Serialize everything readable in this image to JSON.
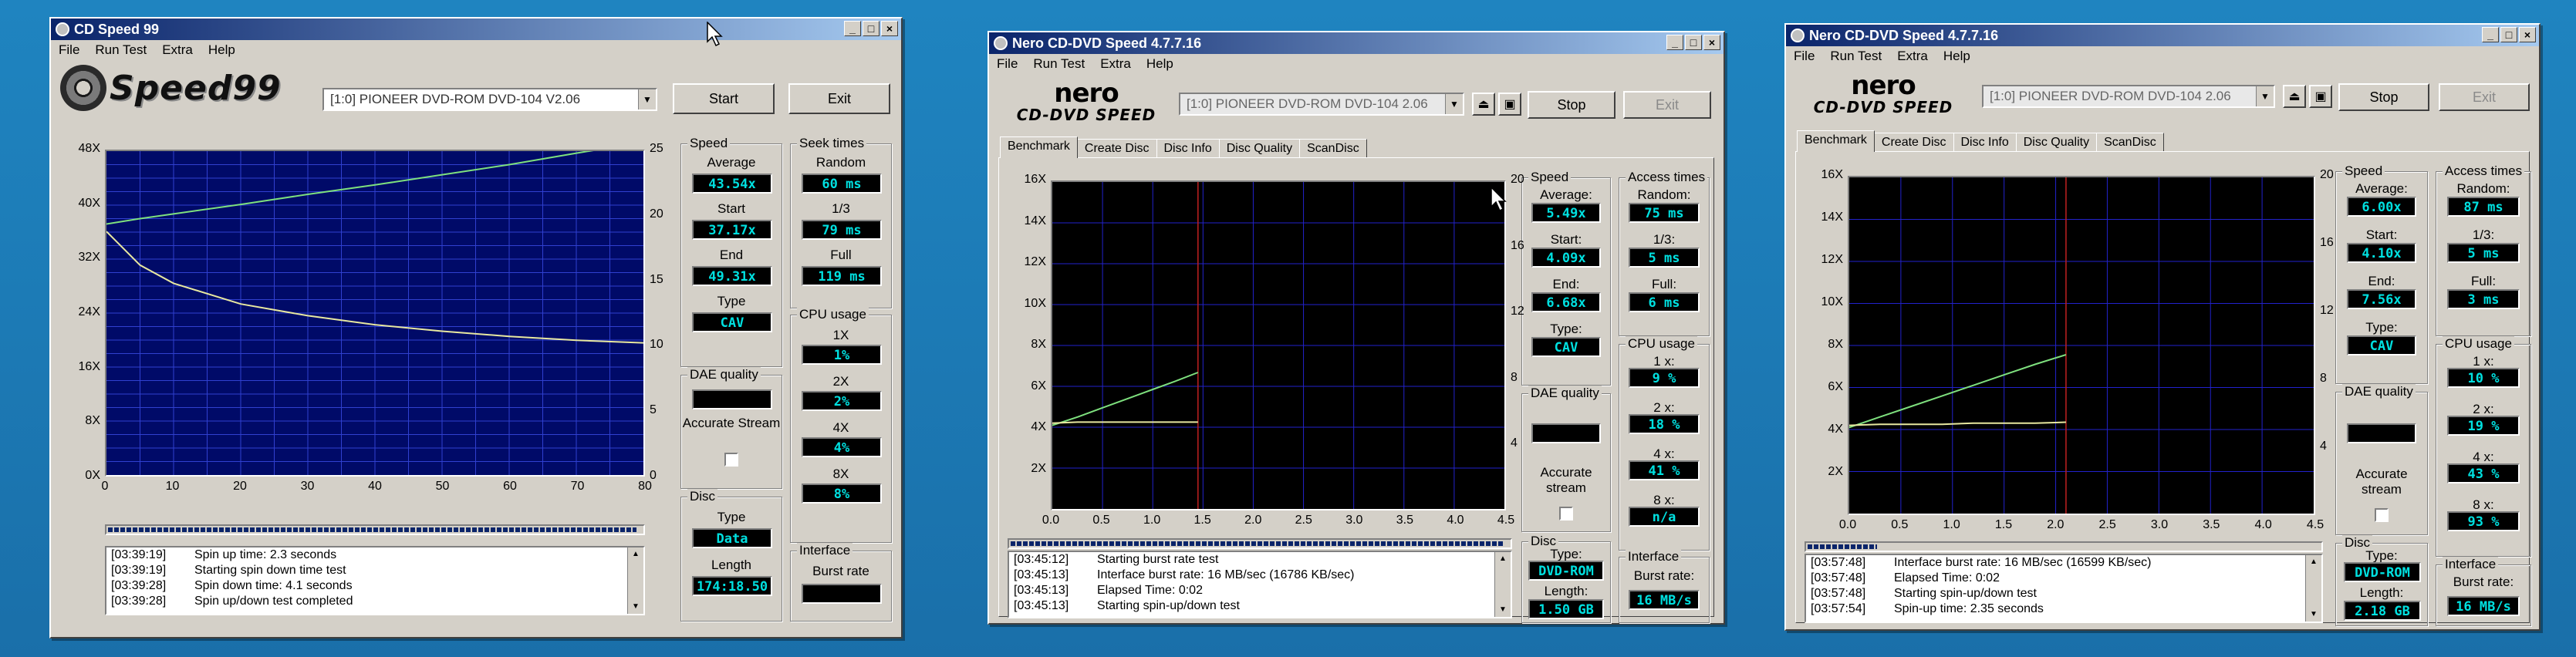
{
  "windows": {
    "w1": {
      "title": "CD Speed 99",
      "menu": [
        "File",
        "Run Test",
        "Extra",
        "Help"
      ],
      "logo_text": "Speed99",
      "drive": "[1:0]  PIONEER DVD-ROM DVD-104 V2.06",
      "start_label": "Start",
      "exit_label": "Exit",
      "speed": {
        "title": "Speed",
        "average_label": "Average",
        "average": "43.54x",
        "start_label": "Start",
        "start": "37.17x",
        "end_label": "End",
        "end": "49.31x",
        "type_label": "Type",
        "type": "CAV"
      },
      "seek": {
        "title": "Seek times",
        "random_label": "Random",
        "random": "60 ms",
        "third_label": "1/3",
        "third": "79 ms",
        "full_label": "Full",
        "full": "119 ms"
      },
      "cpu": {
        "title": "CPU usage",
        "labels": [
          "1X",
          "2X",
          "4X",
          "8X"
        ],
        "values": [
          "1%",
          "2%",
          "4%",
          "8%"
        ]
      },
      "dae": {
        "title": "DAE quality",
        "accurate_label": "Accurate Stream"
      },
      "disc": {
        "title": "Disc",
        "type_label": "Type",
        "type": "Data",
        "length_label": "Length",
        "length": "174:18.50"
      },
      "interface": {
        "title": "Interface",
        "burst_label": "Burst rate"
      },
      "progress": 0.99,
      "log": [
        {
          "t": "[03:39:19]",
          "m": "Spin up time: 2.3 seconds"
        },
        {
          "t": "[03:39:19]",
          "m": "Starting spin down time test"
        },
        {
          "t": "[03:39:28]",
          "m": "Spin down time: 4.1 seconds"
        },
        {
          "t": "[03:39:28]",
          "m": "Spin up/down test completed"
        }
      ]
    },
    "w2": {
      "title": "Nero CD-DVD Speed 4.7.7.16",
      "menu": [
        "File",
        "Run Test",
        "Extra",
        "Help"
      ],
      "logo_top": "nero",
      "logo_bottom": "CD-DVD SPEED",
      "drive": "[1:0]  PIONEER DVD-ROM DVD-104 2.06",
      "stop_label": "Stop",
      "exit_label": "Exit",
      "tabs": [
        "Benchmark",
        "Create Disc",
        "Disc Info",
        "Disc Quality",
        "ScanDisc"
      ],
      "speed": {
        "title": "Speed",
        "average_label": "Average:",
        "average": "5.49x",
        "start_label": "Start:",
        "start": "4.09x",
        "end_label": "End:",
        "end": "6.68x",
        "type_label": "Type:",
        "type": "CAV"
      },
      "access": {
        "title": "Access times",
        "random_label": "Random:",
        "random": "75 ms",
        "third_label": "1/3:",
        "third": "5 ms",
        "full_label": "Full:",
        "full": "6 ms"
      },
      "cpu": {
        "title": "CPU usage",
        "labels": [
          "1 x:",
          "2 x:",
          "4 x:",
          "8 x:"
        ],
        "values": [
          "9 %",
          "18 %",
          "41 %",
          "n/a"
        ]
      },
      "dae": {
        "title": "DAE quality",
        "accurate_label": "Accurate stream"
      },
      "disc": {
        "title": "Disc",
        "type_label": "Type:",
        "type": "DVD-ROM",
        "length_label": "Length:",
        "length": "1.50 GB"
      },
      "interface": {
        "title": "Interface",
        "burst_label": "Burst rate:",
        "burst": "16 MB/s"
      },
      "progress": 0.99,
      "log": [
        {
          "t": "[03:45:12]",
          "m": "Starting burst rate test"
        },
        {
          "t": "[03:45:13]",
          "m": "Interface burst rate: 16 MB/sec (16786 KB/sec)"
        },
        {
          "t": "[03:45:13]",
          "m": "Elapsed Time:  0:02"
        },
        {
          "t": "[03:45:13]",
          "m": "Starting spin-up/down test"
        }
      ]
    },
    "w3": {
      "title": "Nero CD-DVD Speed 4.7.7.16",
      "menu": [
        "File",
        "Run Test",
        "Extra",
        "Help"
      ],
      "logo_top": "nero",
      "logo_bottom": "CD-DVD SPEED",
      "drive": "[1:0]  PIONEER DVD-ROM DVD-104 2.06",
      "stop_label": "Stop",
      "exit_label": "Exit",
      "tabs": [
        "Benchmark",
        "Create Disc",
        "Disc Info",
        "Disc Quality",
        "ScanDisc"
      ],
      "speed": {
        "title": "Speed",
        "average_label": "Average:",
        "average": "6.00x",
        "start_label": "Start:",
        "start": "4.10x",
        "end_label": "End:",
        "end": "7.56x",
        "type_label": "Type:",
        "type": "CAV"
      },
      "access": {
        "title": "Access times",
        "random_label": "Random:",
        "random": "87 ms",
        "third_label": "1/3:",
        "third": "5 ms",
        "full_label": "Full:",
        "full": "3 ms"
      },
      "cpu": {
        "title": "CPU usage",
        "labels": [
          "1 x:",
          "2 x:",
          "4 x:",
          "8 x:"
        ],
        "values": [
          "10 %",
          "19 %",
          "43 %",
          "93 %"
        ]
      },
      "dae": {
        "title": "DAE quality",
        "accurate_label": "Accurate stream"
      },
      "disc": {
        "title": "Disc",
        "type_label": "Type:",
        "type": "DVD-ROM",
        "length_label": "Length:",
        "length": "2.18 GB"
      },
      "interface": {
        "title": "Interface",
        "burst_label": "Burst rate:",
        "burst": "16 MB/s"
      },
      "progress": 0.14,
      "log": [
        {
          "t": "[03:57:48]",
          "m": "Interface burst rate: 16 MB/sec (16599 KB/sec)"
        },
        {
          "t": "[03:57:48]",
          "m": "Elapsed Time:  0:02"
        },
        {
          "t": "[03:57:48]",
          "m": "Starting spin-up/down test"
        },
        {
          "t": "[03:57:54]",
          "m": "Spin-up time: 2.35 seconds"
        }
      ]
    }
  },
  "chart_data": [
    {
      "type": "line",
      "x": [
        0,
        5,
        10,
        20,
        30,
        40,
        50,
        60,
        70,
        80
      ],
      "xlim": [
        0,
        80
      ],
      "ylim": [
        0,
        48
      ],
      "ylim_right": [
        0,
        25
      ],
      "x_ticks": [
        "0",
        "10",
        "20",
        "30",
        "40",
        "50",
        "60",
        "70",
        "80"
      ],
      "y_ticks": [
        "0X",
        "8X",
        "16X",
        "24X",
        "32X",
        "40X",
        "48X"
      ],
      "y_ticks_right": [
        "0",
        "5",
        "10",
        "15",
        "20",
        "25"
      ],
      "series": [
        {
          "color": "#7ee07e",
          "values": [
            37.2,
            38.0,
            38.7,
            40.1,
            41.6,
            43.0,
            44.5,
            46.0,
            47.7,
            49.3
          ]
        },
        {
          "color": "#e8e8a0",
          "axis": "right",
          "values": [
            18.8,
            16.2,
            14.8,
            13.2,
            12.3,
            11.6,
            11.1,
            10.7,
            10.4,
            10.2
          ]
        }
      ]
    },
    {
      "type": "line",
      "x": [
        0,
        0.25,
        0.5,
        0.75,
        1.0,
        1.25,
        1.45
      ],
      "xlim": [
        0,
        4.5
      ],
      "ylim": [
        0,
        16
      ],
      "ylim_right": [
        0,
        20
      ],
      "x_ticks": [
        "0.0",
        "0.5",
        "1.0",
        "1.5",
        "2.0",
        "2.5",
        "3.0",
        "3.5",
        "4.0",
        "4.5"
      ],
      "y_ticks": [
        "",
        "2X",
        "4X",
        "6X",
        "8X",
        "10X",
        "12X",
        "14X",
        "16X"
      ],
      "y_ticks_right": [
        "",
        "4",
        "8",
        "12",
        "16",
        "20"
      ],
      "series": [
        {
          "color": "#7ee07e",
          "values": [
            4.09,
            4.5,
            4.95,
            5.4,
            5.85,
            6.3,
            6.68
          ]
        },
        {
          "color": "#e8e8a0",
          "values": [
            4.2,
            4.25,
            4.25,
            4.25,
            4.25,
            4.25,
            4.25
          ]
        }
      ]
    },
    {
      "type": "line",
      "x": [
        0,
        0.3,
        0.6,
        0.9,
        1.2,
        1.5,
        1.8,
        2.1
      ],
      "xlim": [
        0,
        4.5
      ],
      "ylim": [
        0,
        16
      ],
      "ylim_right": [
        0,
        20
      ],
      "x_ticks": [
        "0.0",
        "0.5",
        "1.0",
        "1.5",
        "2.0",
        "2.5",
        "3.0",
        "3.5",
        "4.0",
        "4.5"
      ],
      "y_ticks": [
        "",
        "2X",
        "4X",
        "6X",
        "8X",
        "10X",
        "12X",
        "14X",
        "16X"
      ],
      "y_ticks_right": [
        "",
        "4",
        "8",
        "12",
        "16",
        "20"
      ],
      "series": [
        {
          "color": "#7ee07e",
          "values": [
            4.1,
            4.6,
            5.1,
            5.6,
            6.1,
            6.6,
            7.1,
            7.56
          ]
        },
        {
          "color": "#e8e8a0",
          "values": [
            4.2,
            4.25,
            4.25,
            4.25,
            4.3,
            4.3,
            4.3,
            4.35
          ]
        }
      ]
    }
  ]
}
